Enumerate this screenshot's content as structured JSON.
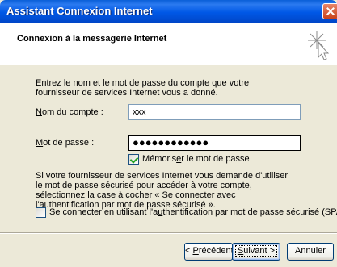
{
  "window": {
    "title": "Assistant Connexion Internet",
    "close_icon": "close-icon"
  },
  "header": {
    "title": "Connexion à la messagerie Internet",
    "icon": "wizard-sparkle-cursor-icon"
  },
  "intro_text": "Entrez le nom et le mot de passe du compte que votre fournisseur de services Internet vous a donné.",
  "account_name": {
    "label_prefix": "",
    "label_accel": "N",
    "label_rest": "om du compte :",
    "value": "xxx"
  },
  "password": {
    "label_accel": "M",
    "label_rest": "ot de passe :",
    "value": "●●●●●●●●●●●●"
  },
  "remember_password": {
    "label_pre": "Mémoris",
    "label_accel": "e",
    "label_post": "r le mot de passe",
    "checked": true
  },
  "spa_info_text": "Si votre fournisseur de services Internet vous demande d'utiliser le mot de passe sécurisé pour accéder à votre compte, sélectionnez la case à cocher « Se connecter avec l'authentification par mot de passe sécurisé ».",
  "spa_checkbox": {
    "label_pre": "Se connecter en utilisant l'a",
    "label_accel": "u",
    "label_post": "thentification par mot de passe sécurisé (SPA)",
    "checked": false
  },
  "buttons": {
    "back": {
      "pre": "< ",
      "accel": "P",
      "post": "récédent"
    },
    "next": {
      "pre": "",
      "accel": "S",
      "post": "uivant >"
    },
    "cancel": "Annuler"
  }
}
